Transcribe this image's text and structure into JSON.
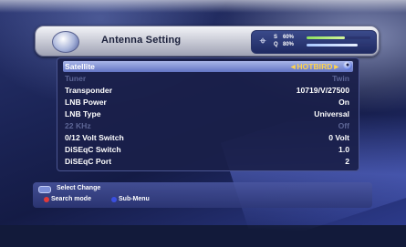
{
  "header": {
    "title": "Antenna Setting",
    "signal": {
      "strength_label": "S",
      "strength_value": "60%",
      "strength_level": 0.6,
      "quality_label": "Q",
      "quality_value": "80%",
      "quality_level": 0.8
    }
  },
  "menu": {
    "items": [
      {
        "label": "Satellite",
        "value": "◄HOTBIRD►",
        "state": "selected"
      },
      {
        "label": "Tuner",
        "value": "Twin",
        "state": "disabled"
      },
      {
        "label": "Transponder",
        "value": "10719/V/27500",
        "state": "normal"
      },
      {
        "label": "LNB Power",
        "value": "On",
        "state": "normal"
      },
      {
        "label": "LNB Type",
        "value": "Universal",
        "state": "normal"
      },
      {
        "label": "22 KHz",
        "value": "Off",
        "state": "disabled"
      },
      {
        "label": "0/12 Volt Switch",
        "value": "0 Volt",
        "state": "normal"
      },
      {
        "label": "DiSEqC Switch",
        "value": "1.0",
        "state": "normal"
      },
      {
        "label": "DiSEqC Port",
        "value": "2",
        "state": "normal"
      }
    ]
  },
  "footer": {
    "select_change": "Select Change",
    "search_mode": "Search mode",
    "sub_menu": "Sub-Menu"
  },
  "colors": {
    "accent": "#ffd34a",
    "selection": "#8a98dc",
    "background": "#1b2456"
  },
  "icons": {
    "header": "satellite-globe-icon",
    "signal": "signal-meter-icon",
    "selected_row": "ok-button-icon"
  }
}
